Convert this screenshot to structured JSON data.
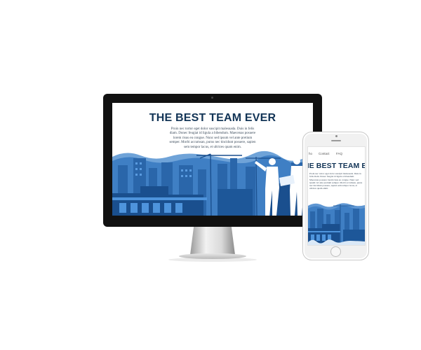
{
  "desktop": {
    "title": "THE BEST TEAM EVER",
    "body": "Proin nec tortor eget dolor suscipit malesuada. Duis in felis diam. Donec feugiat id ligula a bibendum. Maecenas posuere lorem risus eu congue. Nunc sed ipsum vel ante pretium semper. Morbi accumsan, purus nec tincidunt posuere, sapien sem tempor lacus, et ultrices quam enim."
  },
  "mobile": {
    "nav": [
      "ho",
      "Contact",
      "FAQ"
    ],
    "title": "HE BEST TEAM EVER",
    "body": "Proin nec tortor eget dolor suscipit malesuada. Duis in felis diam. Donec feugiat id ligula a bibendum. Maecenas posuere lorem risus eu congue. Nunc sed ipsum vel ante pretium semper. Morbi accumsan, purus nec tincidunt posuere, sapien sem tempor lacus, et ultrices quam enim."
  },
  "colors": {
    "title": "#123456",
    "sky_wave": "#5a8fcb",
    "city_dark": "#1a4f8e",
    "city_mid": "#2f72bf",
    "city_light": "#4e94dc"
  }
}
